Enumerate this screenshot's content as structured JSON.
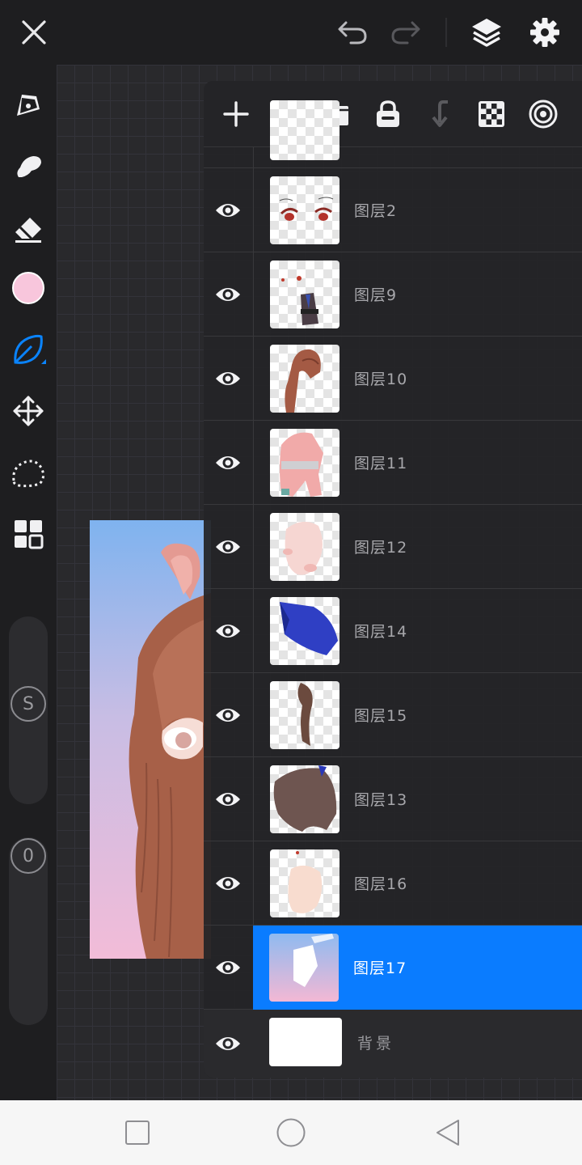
{
  "topbar": {
    "icons": [
      "close-icon",
      "undo-icon",
      "redo-icon",
      "layers-icon",
      "settings-icon"
    ]
  },
  "left_toolbar": {
    "tools": [
      "pen-tool-icon",
      "smudge-tool-icon",
      "eraser-icon",
      "color-swatch",
      "leaf-brush-icon",
      "transform-icon",
      "lasso-select-icon",
      "grid-apps-icon"
    ],
    "current_color": "#f8c6dc",
    "accent_color": "#0a84ff",
    "size_slider_label": "S",
    "opacity_slider_label": "0"
  },
  "layers_panel": {
    "toolbar_icons": [
      "add-layer-icon",
      "folder-icon",
      "lock-icon",
      "merge-down-icon",
      "transparency-checker-icon",
      "blend-mode-icon"
    ],
    "layers": [
      {
        "name": "图层2",
        "thumb": "eyes"
      },
      {
        "name": "图层9",
        "thumb": "outfit"
      },
      {
        "name": "图层10",
        "thumb": "hair-brown"
      },
      {
        "name": "图层11",
        "thumb": "pink-body"
      },
      {
        "name": "图层12",
        "thumb": "pale-shapes"
      },
      {
        "name": "图层14",
        "thumb": "blue-sleeve"
      },
      {
        "name": "图层15",
        "thumb": "hair-strand"
      },
      {
        "name": "图层13",
        "thumb": "hair-dark"
      },
      {
        "name": "图层16",
        "thumb": "skin"
      },
      {
        "name": "图层17",
        "thumb": "gradient",
        "selected": true
      }
    ],
    "background_layer": {
      "name": "背景"
    },
    "selected_color": "#0a7cff"
  },
  "navbar": {
    "icons": [
      "recent-apps-icon",
      "home-icon",
      "back-icon"
    ]
  }
}
